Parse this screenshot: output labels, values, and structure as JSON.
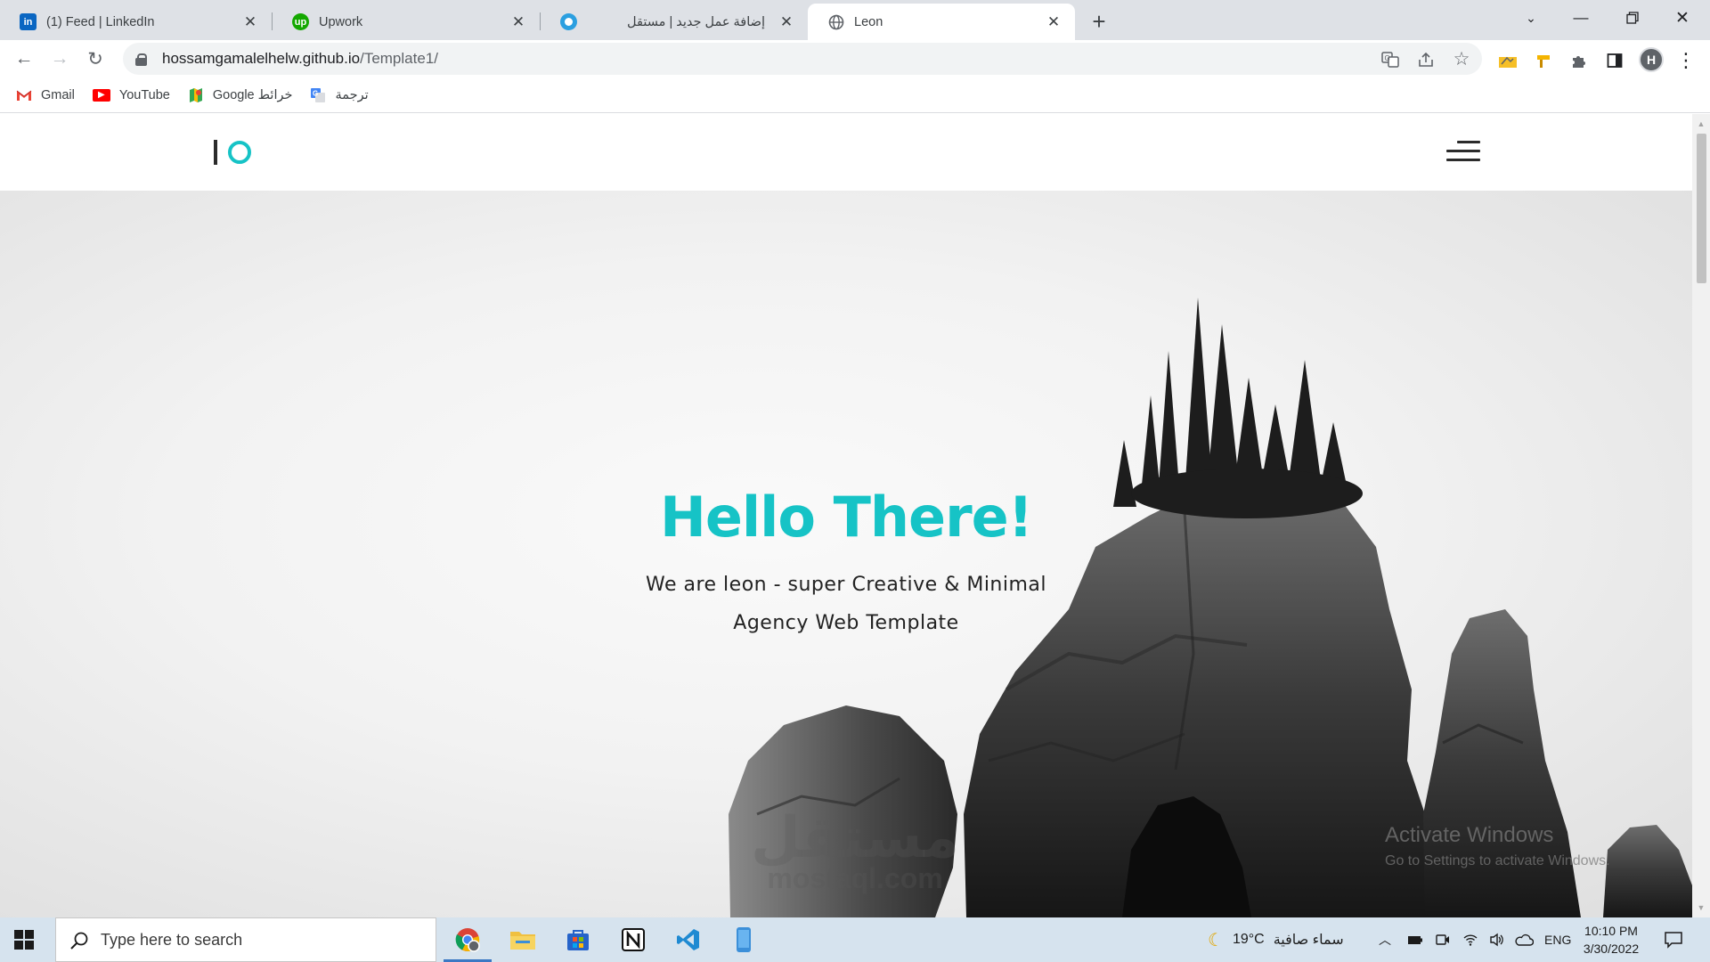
{
  "browser": {
    "tabs": [
      {
        "title": "(1) Feed | LinkedIn",
        "icon": "linkedin-icon",
        "active": false
      },
      {
        "title": "Upwork",
        "icon": "upwork-icon",
        "active": false
      },
      {
        "title": "إضافة عمل جديد | مستقل",
        "icon": "mostaql-icon",
        "active": false
      },
      {
        "title": "Leon",
        "icon": "globe-icon",
        "active": true
      }
    ],
    "url_host": "hossamgamalelhelw.github.io",
    "url_path": "/Template1/",
    "bookmarks": [
      {
        "label": "Gmail",
        "icon": "gmail-icon"
      },
      {
        "label": "YouTube",
        "icon": "youtube-icon"
      },
      {
        "label": "Google خرائط",
        "icon": "google-maps-icon"
      },
      {
        "label": "ترجمة",
        "icon": "google-translate-icon"
      }
    ],
    "profile_initial": "H"
  },
  "page": {
    "hero_title": "Hello There!",
    "hero_line1": "We are leon - super Creative & Minimal",
    "hero_line2": "Agency Web Template",
    "accent_color": "#16c3c6"
  },
  "overlays": {
    "activate_title": "Activate Windows",
    "activate_sub": "Go to Settings to activate Windows.",
    "watermark_ar": "مستقل",
    "watermark_en": "mostaql.com"
  },
  "taskbar": {
    "search_placeholder": "Type here to search",
    "weather_temp": "19°C",
    "weather_text": "سماء صافية",
    "language": "ENG",
    "time": "10:10 PM",
    "date": "3/30/2022"
  }
}
